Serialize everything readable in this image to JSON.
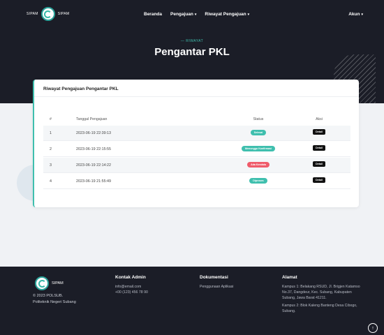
{
  "nav": {
    "brand_left": "SIPAM",
    "brand_right": "SIPAM",
    "links": [
      {
        "label": "Beranda",
        "dropdown": false
      },
      {
        "label": "Pengajuan",
        "dropdown": true
      },
      {
        "label": "Riwayat Pengajuan",
        "dropdown": true
      }
    ],
    "account": "Akun"
  },
  "hero": {
    "eyebrow": "— RIWAYAT",
    "title": "Pengantar PKL"
  },
  "card": {
    "title": "Riwayat Pengajuan Pengantar PKL",
    "columns": [
      "#",
      "Tanggal Pengajuan",
      "Status",
      "Aksi"
    ],
    "rows": [
      {
        "no": "1",
        "date": "2023-06-19 22:39:13",
        "status": "Selesai",
        "status_color": "#3fbfae",
        "action": "Detail"
      },
      {
        "no": "2",
        "date": "2023-06-19 22:15:55",
        "status": "Menunggu Konfirmasi",
        "status_color": "#3fbfae",
        "action": "Detail"
      },
      {
        "no": "3",
        "date": "2023-06-19 22:14:22",
        "status": "Ada Kendala",
        "status_color": "#ef5b6a",
        "action": "Detail"
      },
      {
        "no": "4",
        "date": "2023-06-19 21:55:49",
        "status": "Diproses",
        "status_color": "#3fbfae",
        "action": "Detail"
      }
    ]
  },
  "footer": {
    "brand": "SIPAM",
    "copyright": "© 2023 POLSUB.",
    "institution": "Politeknik Negeri Subang",
    "admin": {
      "heading": "Kontak Admin",
      "email": "info@email.com",
      "phone": "+00 (123) 456 78 90"
    },
    "docs": {
      "heading": "Dokumentasi",
      "link": "Penggunaan Aplikasi"
    },
    "address": {
      "heading": "Alamat",
      "campus1": "Kampus 1: Belakang RSUD, Jl. Brigjen Katamso No.37, Dangdeur, Kec. Subang, Kabupaten Subang, Jawa Barat 41211.",
      "campus2": "Kampus 2: Blok Kaleng Banteng Desa Cibogo, Subang."
    }
  },
  "colors": {
    "accent": "#3fbfae",
    "danger": "#ef5b6a",
    "dark": "#1b1d27"
  },
  "icons": {
    "back_to_top": "arrow-up-icon",
    "logo": "sipam-logo-icon"
  }
}
